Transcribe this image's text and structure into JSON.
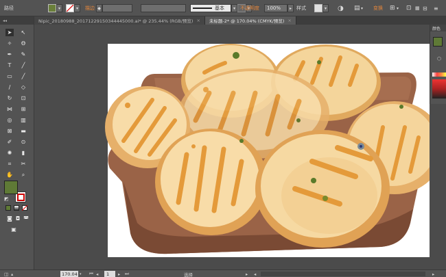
{
  "control_bar": {
    "path_label": "路径",
    "fill_color": "#6a7f3a",
    "stroke_label": "描边",
    "stroke_width": "",
    "profile_label": "基本",
    "opacity_label": "不透明度",
    "opacity_value": "100%",
    "style_label": "样式",
    "transform_label": "变换"
  },
  "tabs": [
    {
      "label": "Nipic_20180988_20171229150344445000.ai* @ 235.44% (RGB/预览)",
      "close": "×"
    },
    {
      "label": "未标题-2* @ 170.04% (CMYK/预览)",
      "close": "×"
    }
  ],
  "tools": {
    "fill_color": "#5f7a36",
    "stroke_color": "#ffffff"
  },
  "color_panel": {
    "title": "颜色",
    "swatch": "#5f7a36"
  },
  "status_bar": {
    "zoom": "170.04",
    "page": "1",
    "tool_name": "选择"
  },
  "colors": {
    "bun_light": "#f8dca8",
    "bun_mid": "#efc27a",
    "bun_outline": "#d9904a",
    "stripe": "#e49a3a",
    "board": "#9a6347",
    "board_dark": "#7a4a34",
    "seed": "#5a7a2a"
  }
}
